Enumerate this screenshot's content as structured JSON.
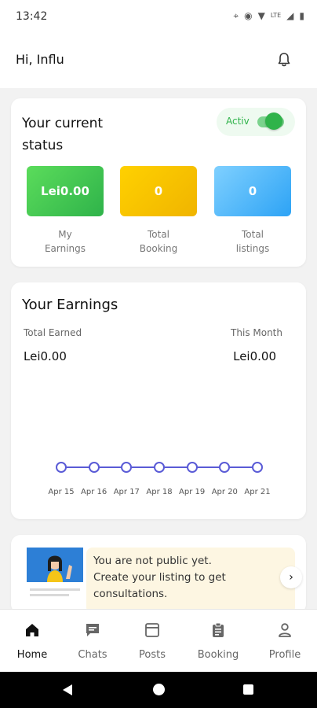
{
  "status_bar": {
    "time": "13:42",
    "network": "LTE"
  },
  "header": {
    "greeting": "Hi, Influ"
  },
  "current_status": {
    "title": "Your current status",
    "toggle_label": "Activ",
    "toggle_on": true,
    "stats": [
      {
        "value": "Lei0.00",
        "caption_line1": "My",
        "caption_line2": "Earnings"
      },
      {
        "value": "0",
        "caption_line1": "Total",
        "caption_line2": "Booking"
      },
      {
        "value": "0",
        "caption_line1": "Total",
        "caption_line2": "listings"
      }
    ]
  },
  "earnings": {
    "title": "Your Earnings",
    "total_label": "Total Earned",
    "total_value": "Lei0.00",
    "month_label": "This Month",
    "month_value": "Lei0.00"
  },
  "chart_data": {
    "type": "line",
    "categories": [
      "Apr 15",
      "Apr 16",
      "Apr 17",
      "Apr 18",
      "Apr 19",
      "Apr 20",
      "Apr 21"
    ],
    "series": [
      {
        "values": [
          0,
          0,
          0,
          0,
          0,
          0,
          0
        ]
      }
    ],
    "title": "",
    "xlabel": "",
    "ylabel": "",
    "color": "#5a5bd6"
  },
  "promo": {
    "line1": "You are not public yet.",
    "line2": "Create your listing to get",
    "line3": "consultations."
  },
  "bottom_nav": {
    "items": [
      {
        "label": "Home",
        "icon": "home-icon"
      },
      {
        "label": "Chats",
        "icon": "chat-icon"
      },
      {
        "label": "Posts",
        "icon": "posts-icon"
      },
      {
        "label": "Booking",
        "icon": "booking-icon"
      },
      {
        "label": "Profile",
        "icon": "profile-icon"
      }
    ]
  },
  "colors": {
    "accent": "#2fb34a",
    "chart": "#5a5bd6",
    "earnings": "#2fb34a",
    "booking": "#f0b400",
    "listings": "#2da3f5"
  }
}
